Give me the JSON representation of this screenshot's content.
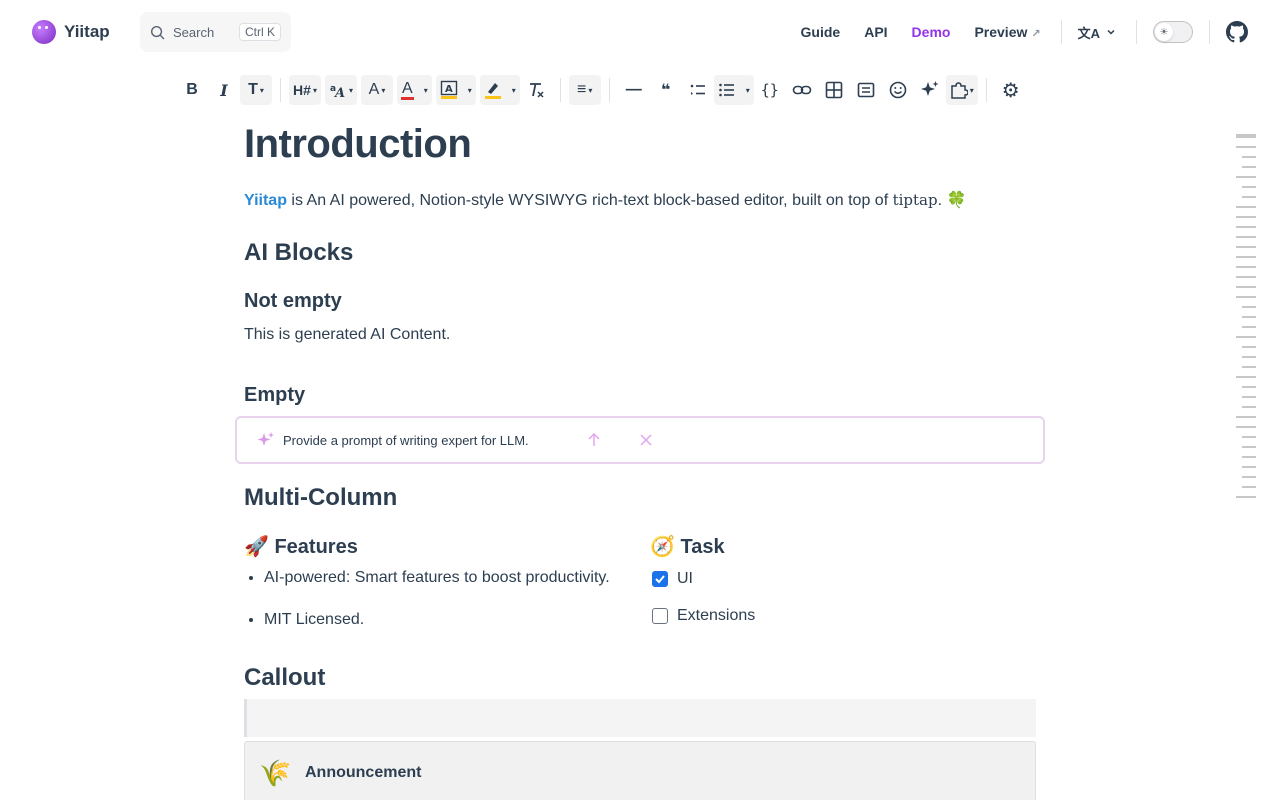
{
  "app": {
    "name": "Yiitap"
  },
  "search": {
    "label": "Search",
    "kbd": "Ctrl K"
  },
  "nav": {
    "guide": "Guide",
    "api": "API",
    "demo": "Demo",
    "preview": "Preview",
    "preview_ext": "↗",
    "lang_icon": "文A"
  },
  "colors": {
    "accent": "#9333ea",
    "brand_link": "#2b8ad6",
    "ai_border": "#e9d3ee",
    "checkbox": "#1a73e8"
  },
  "toolbar": {
    "bold": "B",
    "italic": "I",
    "text_type": "T",
    "heading": "H#",
    "font_size": "A",
    "font_color": "A",
    "highlight": "✎",
    "clear_format": "T̸",
    "align": "≡",
    "divider": "—",
    "quote": "❝",
    "ordered": "☰",
    "code": "{}",
    "settings": "⚙"
  },
  "doc": {
    "title": "Introduction",
    "intro": {
      "brand": "Yiitap",
      "text": " is An AI powered, Notion-style WYSIWYG rich-text block-based editor, built on top of ",
      "tiptap": "tiptap",
      "end": ". ",
      "emoji": "🍀"
    },
    "ai_blocks": "AI Blocks",
    "not_empty": "Not empty",
    "generated": "This is generated AI Content.",
    "empty": "Empty",
    "prompt_placeholder": "Provide a prompt of writing expert for LLM.",
    "multi_column": "Multi-Column",
    "features_heading": "🚀 Features",
    "features": [
      "AI-powered: Smart features to boost productivity.",
      "MIT Licensed."
    ],
    "task_heading": "🧭 Task",
    "tasks": [
      {
        "label": "UI",
        "checked": true
      },
      {
        "label": "Extensions",
        "checked": false
      }
    ],
    "callout": "Callout",
    "callout_emoji": "🌾",
    "announcement": "Announcement"
  }
}
